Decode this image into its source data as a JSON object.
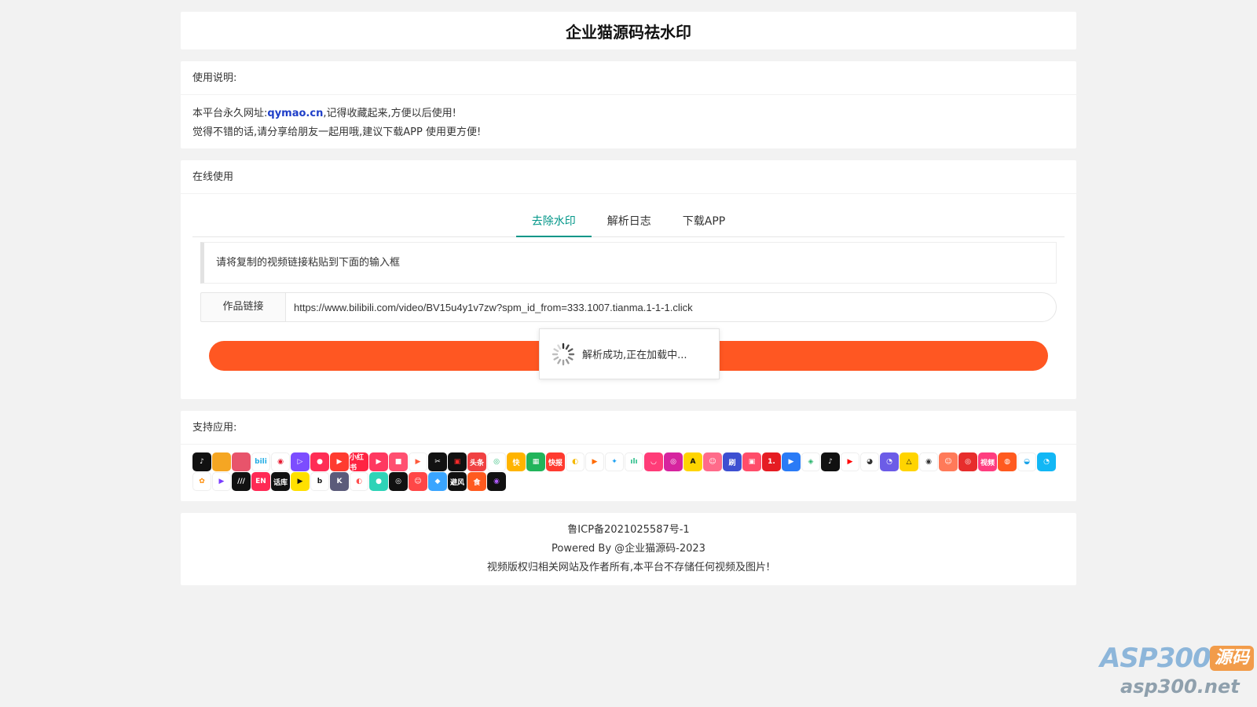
{
  "header": {
    "title": "企业猫源码祛水印"
  },
  "intro": {
    "heading": "使用说明:",
    "line1_prefix": "本平台永久网址:",
    "site": "qymao.cn",
    "line1_suffix": ",记得收藏起来,方便以后使用!",
    "line2": "觉得不错的话,请分享给朋友一起用哦,建议下载APP 使用更方便!"
  },
  "online": {
    "heading": "在线使用",
    "tabs": [
      {
        "label": "去除水印",
        "active": true
      },
      {
        "label": "解析日志",
        "active": false
      },
      {
        "label": "下载APP",
        "active": false
      }
    ],
    "hint": "请将复制的视频链接粘贴到下面的输入框",
    "link_label": "作品链接",
    "link_value": "https://www.bilibili.com/video/BV15u4y1v7zw?spm_id_from=333.1007.tianma.1-1-1.click",
    "button_color": "#ff5722",
    "toast": "解析成功,正在加载中..."
  },
  "support": {
    "heading": "支持应用:",
    "icons": [
      {
        "name": "douyin-icon",
        "bg": "#111111",
        "t": "♪"
      },
      {
        "name": "app-icon-2",
        "bg": "#f5a623",
        "t": ""
      },
      {
        "name": "app-icon-3",
        "bg": "#e8546b",
        "t": ""
      },
      {
        "name": "bilibili-icon",
        "bg": "#ffffff",
        "t": "bili",
        "c": "#23ade5"
      },
      {
        "name": "weibo-icon",
        "bg": "#ffffff",
        "t": "◉",
        "c": "#e6162d"
      },
      {
        "name": "app-icon-6",
        "bg": "#7c4dff",
        "t": "▷"
      },
      {
        "name": "app-icon-7",
        "bg": "#ff2d55",
        "t": "●"
      },
      {
        "name": "app-icon-8",
        "bg": "#ff3b30",
        "t": "▶"
      },
      {
        "name": "xiaohongshu-icon",
        "bg": "#ff2442",
        "t": "小红书"
      },
      {
        "name": "app-icon-10",
        "bg": "#ff3860",
        "t": "▶"
      },
      {
        "name": "app-icon-11",
        "bg": "#ff4f70",
        "t": "■"
      },
      {
        "name": "app-icon-12",
        "bg": "#ffffff",
        "t": "▶",
        "c": "#ff5a3c"
      },
      {
        "name": "capcut-icon",
        "bg": "#111111",
        "t": "✂"
      },
      {
        "name": "app-icon-14",
        "bg": "#111111",
        "t": "▣",
        "c": "#ff2a2a"
      },
      {
        "name": "toutiao-icon",
        "bg": "#f04142",
        "t": "头条"
      },
      {
        "name": "app-icon-16",
        "bg": "#ffffff",
        "t": "◎",
        "c": "#2dbd7a"
      },
      {
        "name": "kuaishou-icon",
        "bg": "#ffb400",
        "t": "快"
      },
      {
        "name": "app-icon-18",
        "bg": "#21b45b",
        "t": "▦"
      },
      {
        "name": "kuaibao-icon",
        "bg": "#ff3b30",
        "t": "快报"
      },
      {
        "name": "app-icon-20",
        "bg": "#ffffff",
        "t": "◐",
        "c": "#f5b800"
      },
      {
        "name": "app-icon-21",
        "bg": "#ffffff",
        "t": "▶",
        "c": "#ff6a00"
      },
      {
        "name": "twitter-icon",
        "bg": "#ffffff",
        "t": "✦",
        "c": "#1da1f2"
      },
      {
        "name": "app-icon-23",
        "bg": "#ffffff",
        "t": "ılı",
        "c": "#2bbf8a"
      },
      {
        "name": "app-icon-24",
        "bg": "#ff3c78",
        "t": "◡"
      },
      {
        "name": "instagram-icon",
        "bg": "#d6249f",
        "t": "◎"
      },
      {
        "name": "app-icon-26",
        "bg": "#ffd400",
        "t": "A",
        "c": "#111111"
      },
      {
        "name": "app-icon-27",
        "bg": "#ff6b8a",
        "t": "☺"
      },
      {
        "name": "app-icon-28",
        "bg": "#3d4fd1",
        "t": "刷"
      },
      {
        "name": "app-icon-29",
        "bg": "#ff4d6a",
        "t": "▣"
      },
      {
        "name": "app-icon-30",
        "bg": "#e51c23",
        "t": "1."
      },
      {
        "name": "app-icon-31",
        "bg": "#2a7bf6",
        "t": "▶"
      },
      {
        "name": "app-icon-32",
        "bg": "#ffffff",
        "t": "◈",
        "c": "#26b36b"
      },
      {
        "name": "tiktok-icon",
        "bg": "#111111",
        "t": "♪"
      },
      {
        "name": "youtube-icon",
        "bg": "#ffffff",
        "t": "▶",
        "c": "#ff0000"
      },
      {
        "name": "app-icon-35",
        "bg": "#ffffff",
        "t": "◕",
        "c": "#333333"
      },
      {
        "name": "app-icon-36",
        "bg": "#6c5ce7",
        "t": "◔"
      },
      {
        "name": "app-icon-37",
        "bg": "#ffd400",
        "t": "△",
        "c": "#111111"
      },
      {
        "name": "app-icon-38",
        "bg": "#ffffff",
        "t": "◉",
        "c": "#333333"
      },
      {
        "name": "app-icon-39",
        "bg": "#ff7a59",
        "t": "☺"
      },
      {
        "name": "netease-music-icon",
        "bg": "#e72d2c",
        "t": "◎"
      },
      {
        "name": "app-icon-41",
        "bg": "#ff3d7f",
        "t": "视频"
      },
      {
        "name": "app-icon-42",
        "bg": "#ff5a1f",
        "t": "◍"
      },
      {
        "name": "app-icon-43",
        "bg": "#ffffff",
        "t": "◒",
        "c": "#1aa3e8"
      },
      {
        "name": "qq-icon",
        "bg": "#12b7f5",
        "t": "◔"
      },
      {
        "name": "uc-icon",
        "bg": "#ffffff",
        "t": "✿",
        "c": "#ff8a00"
      },
      {
        "name": "app-icon-46",
        "bg": "#ffffff",
        "t": "▶",
        "c": "#7a3cff"
      },
      {
        "name": "app-icon-47",
        "bg": "#111111",
        "t": "///"
      },
      {
        "name": "app-icon-48",
        "bg": "#ff2a55",
        "t": "EN"
      },
      {
        "name": "app-icon-49",
        "bg": "#111111",
        "t": "话库"
      },
      {
        "name": "app-icon-50",
        "bg": "#ffe000",
        "t": "▶",
        "c": "#111111"
      },
      {
        "name": "app-icon-51",
        "bg": "#ffffff",
        "t": "b",
        "c": "#111111"
      },
      {
        "name": "app-icon-52",
        "bg": "#5b5b7a",
        "t": "K"
      },
      {
        "name": "app-icon-53",
        "bg": "#ffffff",
        "t": "◐",
        "c": "#ff4e4e"
      },
      {
        "name": "app-icon-54",
        "bg": "#2ed3b7",
        "t": "●"
      },
      {
        "name": "app-icon-55",
        "bg": "#111111",
        "t": "◎"
      },
      {
        "name": "app-icon-56",
        "bg": "#ff4747",
        "t": "☺"
      },
      {
        "name": "app-icon-57",
        "bg": "#3aa5ff",
        "t": "◆"
      },
      {
        "name": "app-icon-58",
        "bg": "#111111",
        "t": "避风"
      },
      {
        "name": "app-icon-59",
        "bg": "#ff5a1f",
        "t": "食"
      },
      {
        "name": "app-icon-60",
        "bg": "#111111",
        "t": "◉",
        "c": "#b05cff"
      }
    ]
  },
  "footer": {
    "icp": "鲁ICP备2021025587号-1",
    "powered": "Powered By @企业猫源码-2023",
    "disclaimer": "视频版权归相关网站及作者所有,本平台不存储任何视频及图片!"
  },
  "watermark": {
    "brand": "ASP300",
    "tag": "源码",
    "url": "asp300.net"
  }
}
